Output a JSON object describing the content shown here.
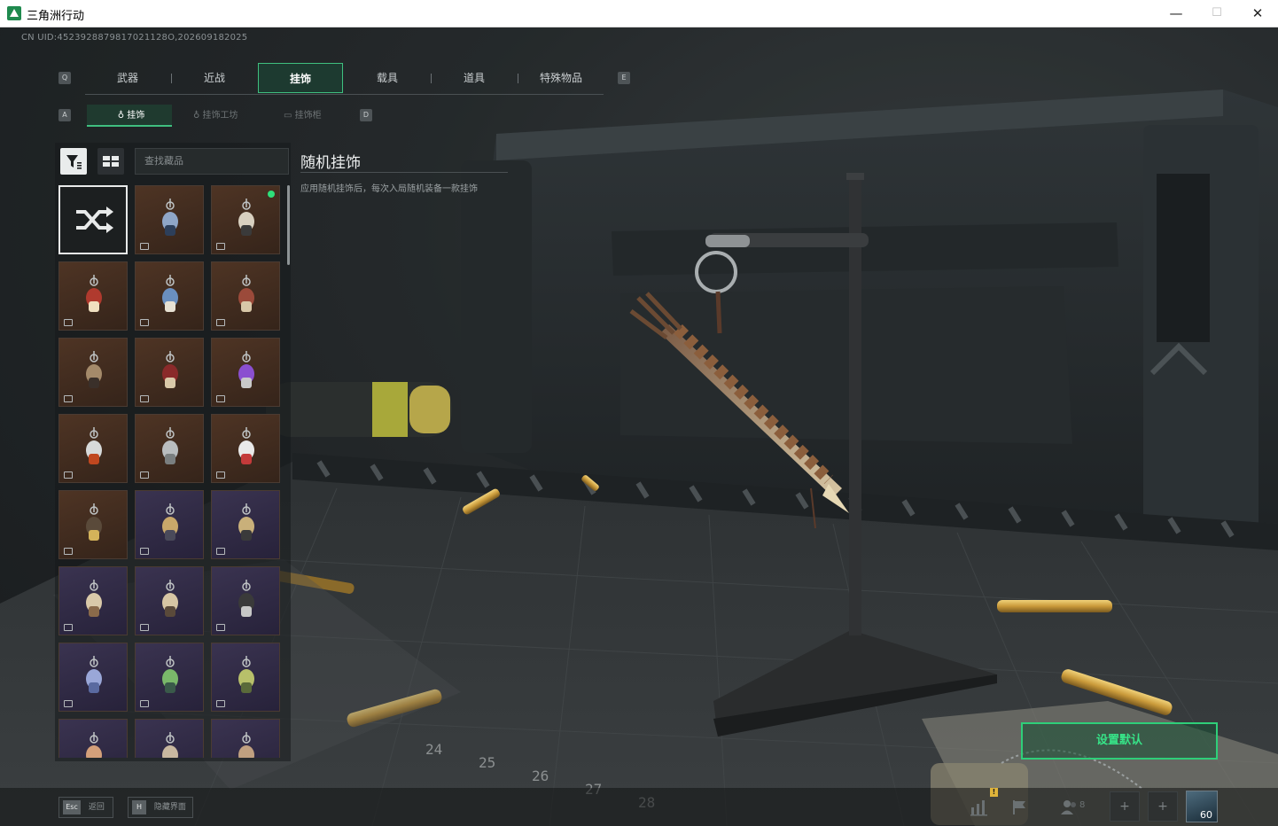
{
  "window": {
    "title": "三角洲行动",
    "minimize": "—",
    "maximize": "☐",
    "close": "✕"
  },
  "uid_text": "CN UID:4523928879817021128O,202609182025",
  "tabs": {
    "prev_key": "Q",
    "next_key": "E",
    "items": [
      {
        "label": "武器",
        "active": false
      },
      {
        "label": "近战",
        "active": false
      },
      {
        "label": "挂饰",
        "active": true
      },
      {
        "label": "载具",
        "active": false
      },
      {
        "label": "道具",
        "active": false
      },
      {
        "label": "特殊物品",
        "active": false
      }
    ]
  },
  "subtabs": {
    "prev_key": "A",
    "next_key": "D",
    "items": [
      {
        "label": "挂饰",
        "active": true
      },
      {
        "label": "挂饰工坊",
        "active": false
      },
      {
        "label": "挂饰柜",
        "active": false
      }
    ]
  },
  "search": {
    "placeholder": "查找藏品"
  },
  "grid": {
    "items": [
      {
        "kind": "random",
        "rarity": "none",
        "selected": true
      },
      {
        "kind": "charm",
        "rarity": "brown",
        "new": false
      },
      {
        "kind": "charm",
        "rarity": "brown",
        "new": true
      },
      {
        "kind": "charm",
        "rarity": "brown",
        "new": false
      },
      {
        "kind": "charm",
        "rarity": "brown",
        "new": false
      },
      {
        "kind": "charm",
        "rarity": "brown",
        "new": false
      },
      {
        "kind": "charm",
        "rarity": "brown",
        "new": false
      },
      {
        "kind": "charm",
        "rarity": "brown",
        "new": false
      },
      {
        "kind": "charm",
        "rarity": "brown",
        "new": false
      },
      {
        "kind": "charm",
        "rarity": "brown",
        "new": false
      },
      {
        "kind": "charm",
        "rarity": "brown",
        "new": false
      },
      {
        "kind": "charm",
        "rarity": "brown",
        "new": false
      },
      {
        "kind": "charm",
        "rarity": "brown",
        "new": false
      },
      {
        "kind": "charm",
        "rarity": "purple",
        "new": false
      },
      {
        "kind": "charm",
        "rarity": "purple",
        "new": false
      },
      {
        "kind": "charm",
        "rarity": "purple",
        "new": false
      },
      {
        "kind": "charm",
        "rarity": "purple",
        "new": false
      },
      {
        "kind": "charm",
        "rarity": "purple",
        "new": false
      },
      {
        "kind": "charm",
        "rarity": "purple",
        "new": false
      },
      {
        "kind": "charm",
        "rarity": "purple",
        "new": false
      },
      {
        "kind": "charm",
        "rarity": "purple",
        "new": false
      },
      {
        "kind": "charm",
        "rarity": "purple",
        "new": false
      },
      {
        "kind": "charm",
        "rarity": "purple",
        "new": false
      },
      {
        "kind": "charm",
        "rarity": "purple",
        "new": false
      }
    ]
  },
  "detail": {
    "title": "随机挂饰",
    "description": "应用随机挂饰后，每次入局随机装备一款挂饰"
  },
  "set_default_label": "设置默认",
  "bottom": {
    "back_key": "Esc",
    "back_label": "返回",
    "hide_key": "H",
    "hide_label": "隐藏界面",
    "friends_count": "8",
    "level": "60"
  },
  "colors": {
    "accent": "#3fbf7f",
    "new_dot": "#2ee07a",
    "rarity_brown": "#4e3424",
    "rarity_purple": "#3a3350"
  }
}
